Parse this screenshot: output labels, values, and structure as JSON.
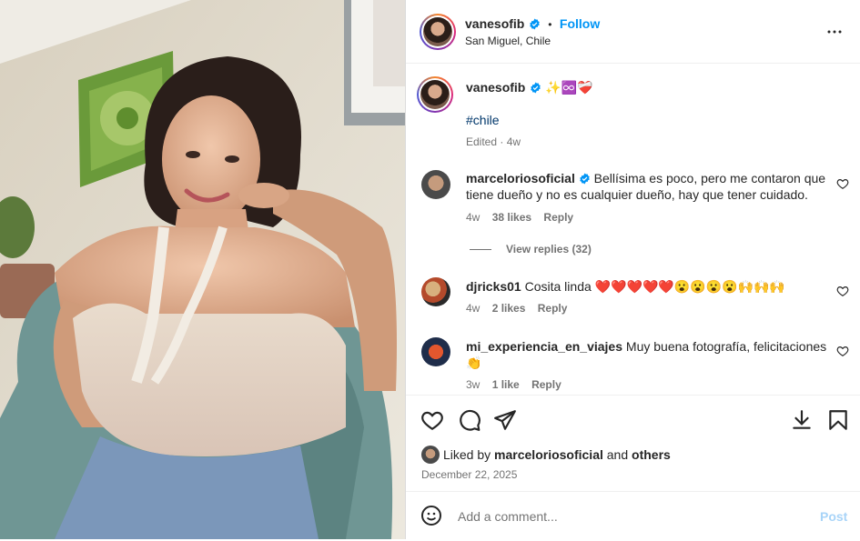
{
  "post": {
    "username": "vanesofib",
    "follow_label": "Follow",
    "dot": "•",
    "location": "San Miguel, Chile",
    "caption_emojis": "✨♾️❤️‍🩹",
    "hashtag": "#chile",
    "edited": "Edited · 4w",
    "more_icon": "more-horizontal-icon"
  },
  "comments": [
    {
      "username": "marceloriosoficial",
      "verified": true,
      "text": "Bellísima es poco, pero me contaron que tiene dueño y no es cualquier dueño, hay que tener cuidado.",
      "time": "4w",
      "likes": "38 likes",
      "reply": "Reply",
      "view_replies": "View replies (32)"
    },
    {
      "username": "djricks01",
      "text": "Cosita linda",
      "emojis": "❤️❤️❤️❤️❤️😮😮😮😮🙌🙌🙌",
      "time": "4w",
      "likes": "2 likes",
      "reply": "Reply"
    },
    {
      "username": "mi_experiencia_en_viajes",
      "text": "Muy buena fotografía, felicitaciones",
      "emojis": "👏",
      "time": "3w",
      "likes": "1 like",
      "reply": "Reply"
    }
  ],
  "liked_by": {
    "prefix": "Liked by ",
    "user": "marceloriosoficial",
    "and": " and ",
    "others": "others"
  },
  "date": "December 22, 2025",
  "add_comment": {
    "placeholder": "Add a comment...",
    "post_label": "Post"
  },
  "colors": {
    "accent": "#0095f6",
    "hashtag": "#00376b",
    "muted": "#737373",
    "heart_red": "#ed4956"
  }
}
